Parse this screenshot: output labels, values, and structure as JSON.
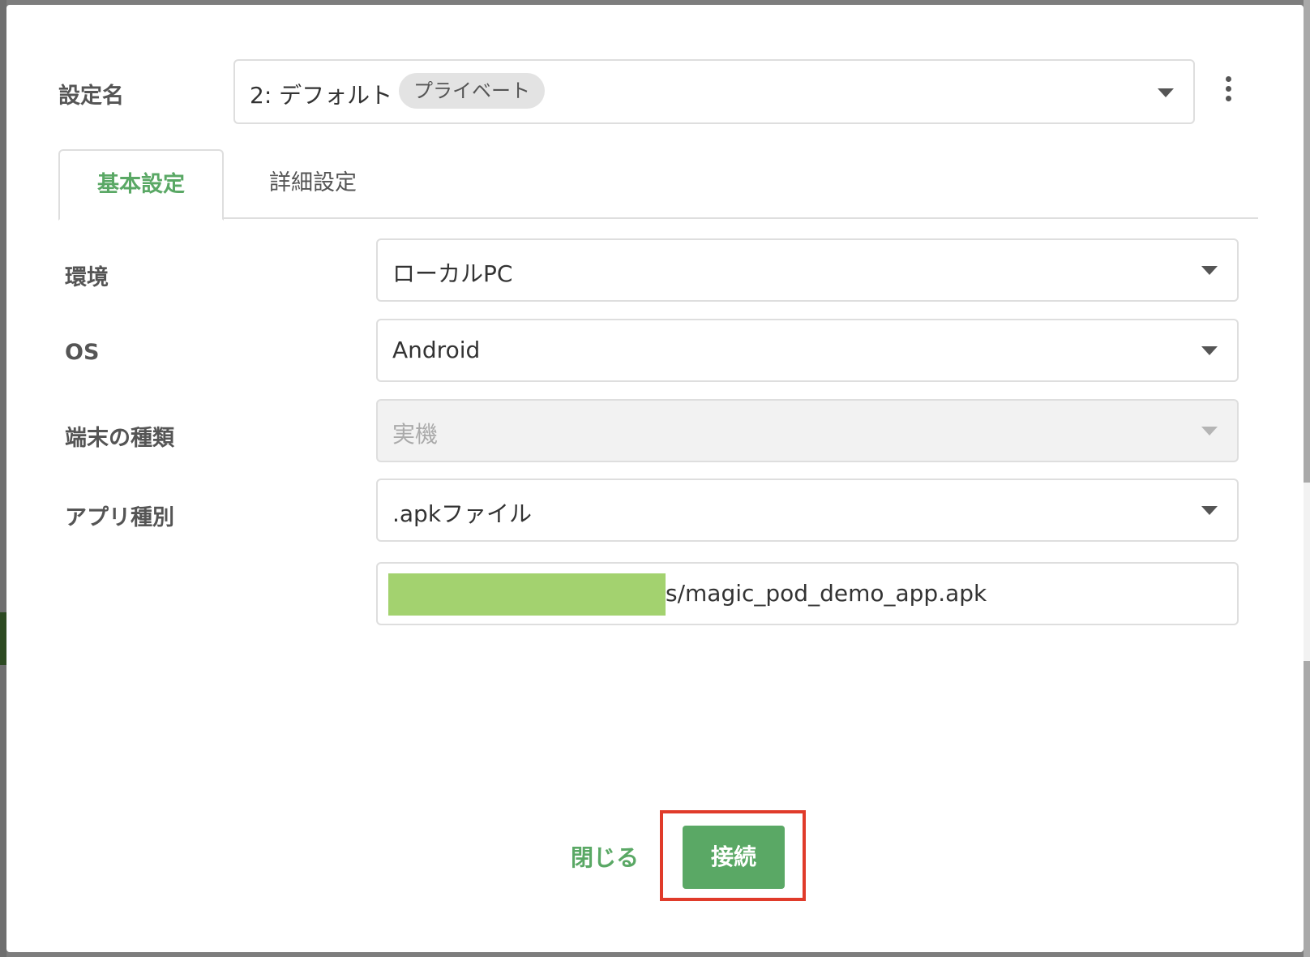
{
  "config": {
    "label": "設定名",
    "selected": "2: デフォルト",
    "badge": "プライベート"
  },
  "tabs": [
    {
      "label": "基本設定",
      "active": true
    },
    {
      "label": "詳細設定",
      "active": false
    }
  ],
  "form": {
    "environment": {
      "label": "環境",
      "value": "ローカルPC"
    },
    "os": {
      "label": "OS",
      "value": "Android"
    },
    "device_type": {
      "label": "端末の種類",
      "value": "実機",
      "disabled": true
    },
    "app_type": {
      "label": "アプリ種別",
      "value": ".apkファイル"
    },
    "app_path": {
      "visible_suffix": "s/magic_pod_demo_app.apk"
    }
  },
  "footer": {
    "close_label": "閉じる",
    "connect_label": "接続"
  },
  "colors": {
    "accent": "#5aa865",
    "highlight": "#e03b2a",
    "redaction": "#a3d26f"
  }
}
